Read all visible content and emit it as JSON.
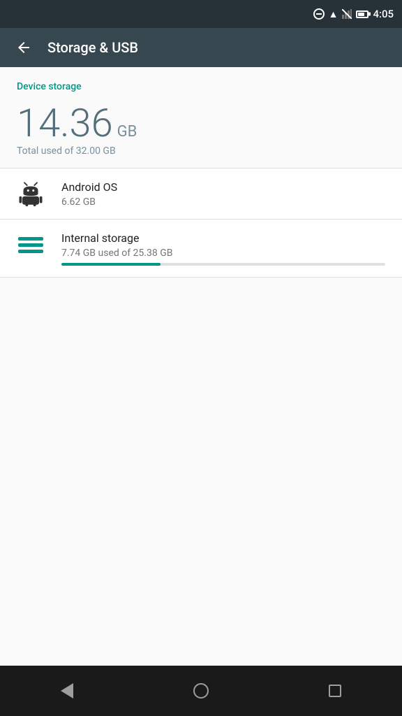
{
  "statusBar": {
    "time": "4:05",
    "icons": [
      "dnd",
      "wifi",
      "signal",
      "battery"
    ]
  },
  "toolbar": {
    "backLabel": "←",
    "title": "Storage & USB"
  },
  "deviceStorage": {
    "sectionLabel": "Device storage",
    "usedAmount": "14.36",
    "usedUnit": "GB",
    "totalLabel": "Total used of 32.00 GB"
  },
  "items": [
    {
      "id": "android-os",
      "title": "Android OS",
      "subtitle": "6.62 GB",
      "iconType": "android"
    },
    {
      "id": "internal-storage",
      "title": "Internal storage",
      "subtitle": "7.74 GB used of 25.38 GB",
      "iconType": "storage",
      "progressPercent": 30.5
    }
  ],
  "navBar": {
    "backLabel": "Back",
    "homeLabel": "Home",
    "recentsLabel": "Recents"
  },
  "colors": {
    "teal": "#009688",
    "darkHeader": "#37474f",
    "darkStatusBar": "#263238"
  }
}
